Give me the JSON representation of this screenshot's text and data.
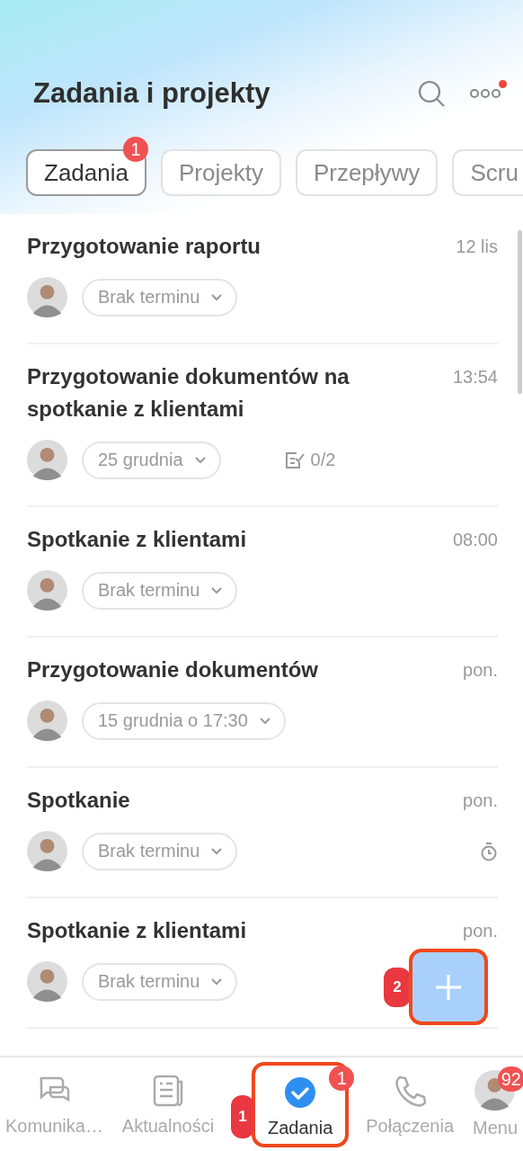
{
  "header": {
    "title": "Zadania i projekty",
    "more_has_notification": true
  },
  "tabs": [
    {
      "label": "Zadania",
      "selected": true,
      "badge": "1"
    },
    {
      "label": "Projekty",
      "selected": false
    },
    {
      "label": "Przepływy",
      "selected": false
    },
    {
      "label": "Scru",
      "selected": false
    }
  ],
  "tasks": [
    {
      "title": "Przygotowanie raportu",
      "time": "12 lis",
      "deadline": "Brak terminu"
    },
    {
      "title": "Przygotowanie dokumentów na spotkanie z klientami",
      "time": "13:54",
      "deadline": "25 grudnia",
      "checklist": "0/2"
    },
    {
      "title": "Spotkanie z klientami",
      "time": "08:00",
      "deadline": "Brak terminu"
    },
    {
      "title": "Przygotowanie dokumentów",
      "time": "pon.",
      "deadline": "15 grudnia o 17:30"
    },
    {
      "title": "Spotkanie",
      "time": "pon.",
      "deadline": "Brak terminu",
      "timer": true
    },
    {
      "title": "Spotkanie z klientami",
      "time": "pon.",
      "deadline": "Brak terminu"
    }
  ],
  "fab": {
    "callout": "2"
  },
  "nav": [
    {
      "kind": "chat",
      "label": "Komunika…",
      "selected": false
    },
    {
      "kind": "news",
      "label": "Aktualności",
      "selected": false
    },
    {
      "kind": "tasks",
      "label": "Zadania",
      "selected": true,
      "badge": "1",
      "callout": "1"
    },
    {
      "kind": "calls",
      "label": "Połączenia",
      "selected": false
    },
    {
      "kind": "menu",
      "label": "Menu",
      "selected": false,
      "badge": "92"
    }
  ]
}
